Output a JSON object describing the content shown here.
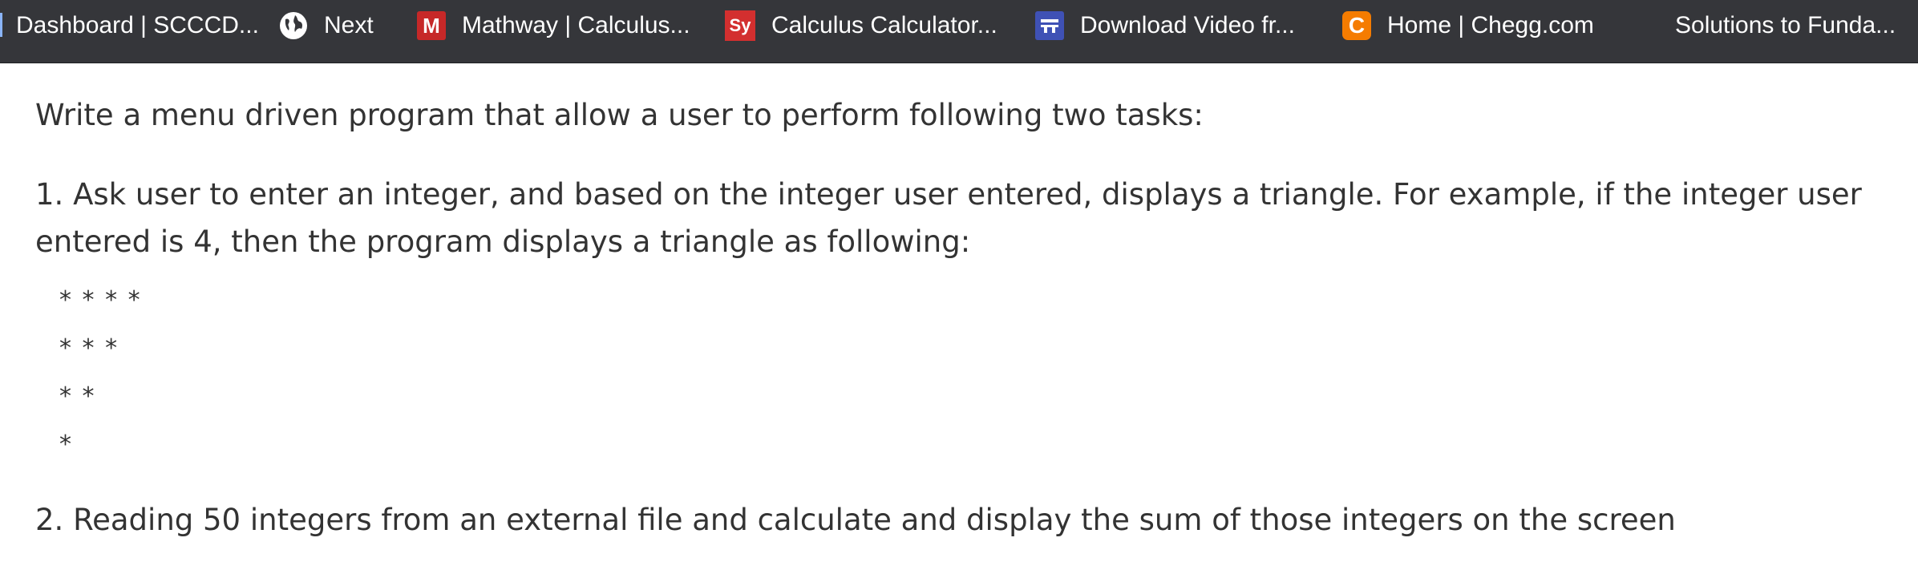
{
  "bookmarks": [
    {
      "label": "Dashboard | SCCCD...",
      "icon": "none"
    },
    {
      "label": "Next",
      "icon": "globe-icon"
    },
    {
      "label": "Mathway | Calculus...",
      "icon": "mathway-logo-icon",
      "icon_text": "M"
    },
    {
      "label": "Calculus Calculator...",
      "icon": "symbolab-logo-icon",
      "icon_text": "Sy"
    },
    {
      "label": "Download Video fr...",
      "icon": "download-site-icon"
    },
    {
      "label": "Home | Chegg.com",
      "icon": "chegg-logo-icon",
      "icon_text": "C"
    },
    {
      "label": "Solutions to Funda...",
      "icon": "none"
    }
  ],
  "question": {
    "intro": "Write a menu driven program that allow a user to perform following two tasks:",
    "task1": "1. Ask user to enter an integer, and based on the integer user entered, displays a triangle. For example, if the integer user entered is 4, then the program displays a triangle as following:",
    "triangle": [
      "* * * *",
      "* * *",
      "* *",
      "*"
    ],
    "task2": "2. Reading 50 integers from an external file and calculate and display the sum of those integers on the screen"
  },
  "colors": {
    "bar": "#35363a",
    "text": "#333333",
    "mathway": "#c62828",
    "symbolab": "#d32f2f",
    "download": "#3f51b5",
    "chegg": "#f57c00"
  }
}
